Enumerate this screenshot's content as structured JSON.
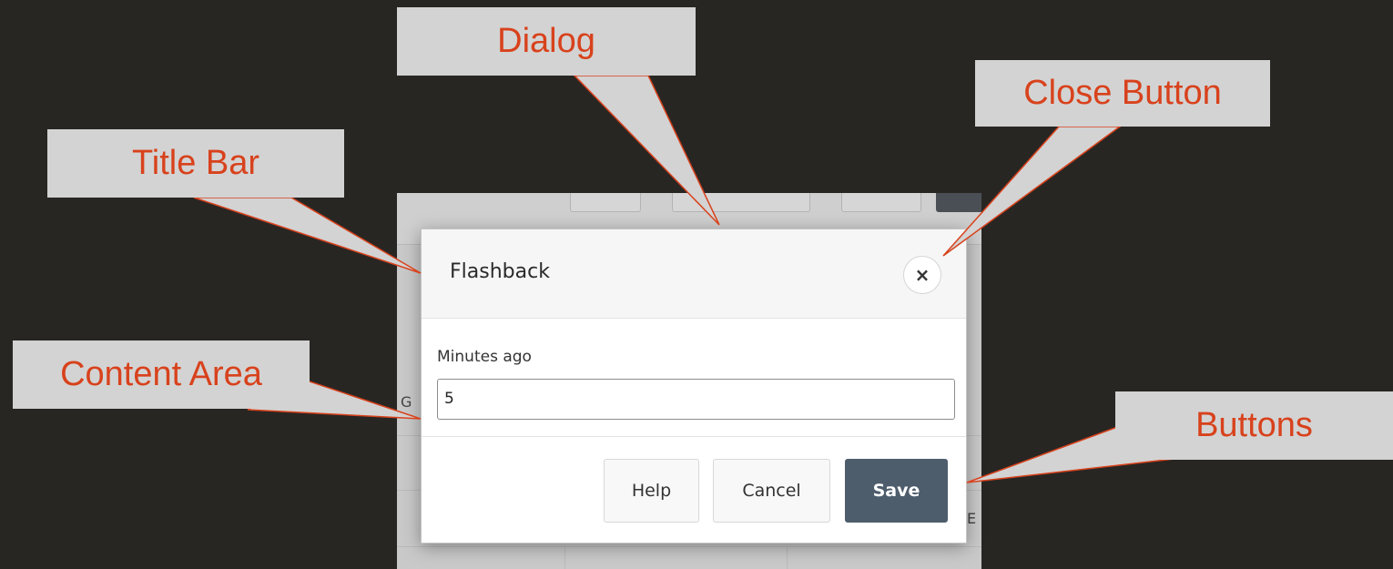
{
  "dialog": {
    "title": "Flashback",
    "close_symbol": "×",
    "field_label": "Minutes ago",
    "field_value": "5",
    "buttons": {
      "help": "Help",
      "cancel": "Cancel",
      "save": "Save"
    }
  },
  "background_fragments": {
    "left_letter": "G",
    "right_letter": "E"
  },
  "callouts": {
    "dialog": "Dialog",
    "close_button": "Close Button",
    "title_bar": "Title Bar",
    "content_area": "Content Area",
    "buttons": "Buttons"
  },
  "colors": {
    "page_background": "#282623",
    "callout_fill": "#d3d3d3",
    "callout_text": "#d8421c",
    "primary_button": "#4e5d6c"
  },
  "icons": {
    "close": "close-icon"
  }
}
